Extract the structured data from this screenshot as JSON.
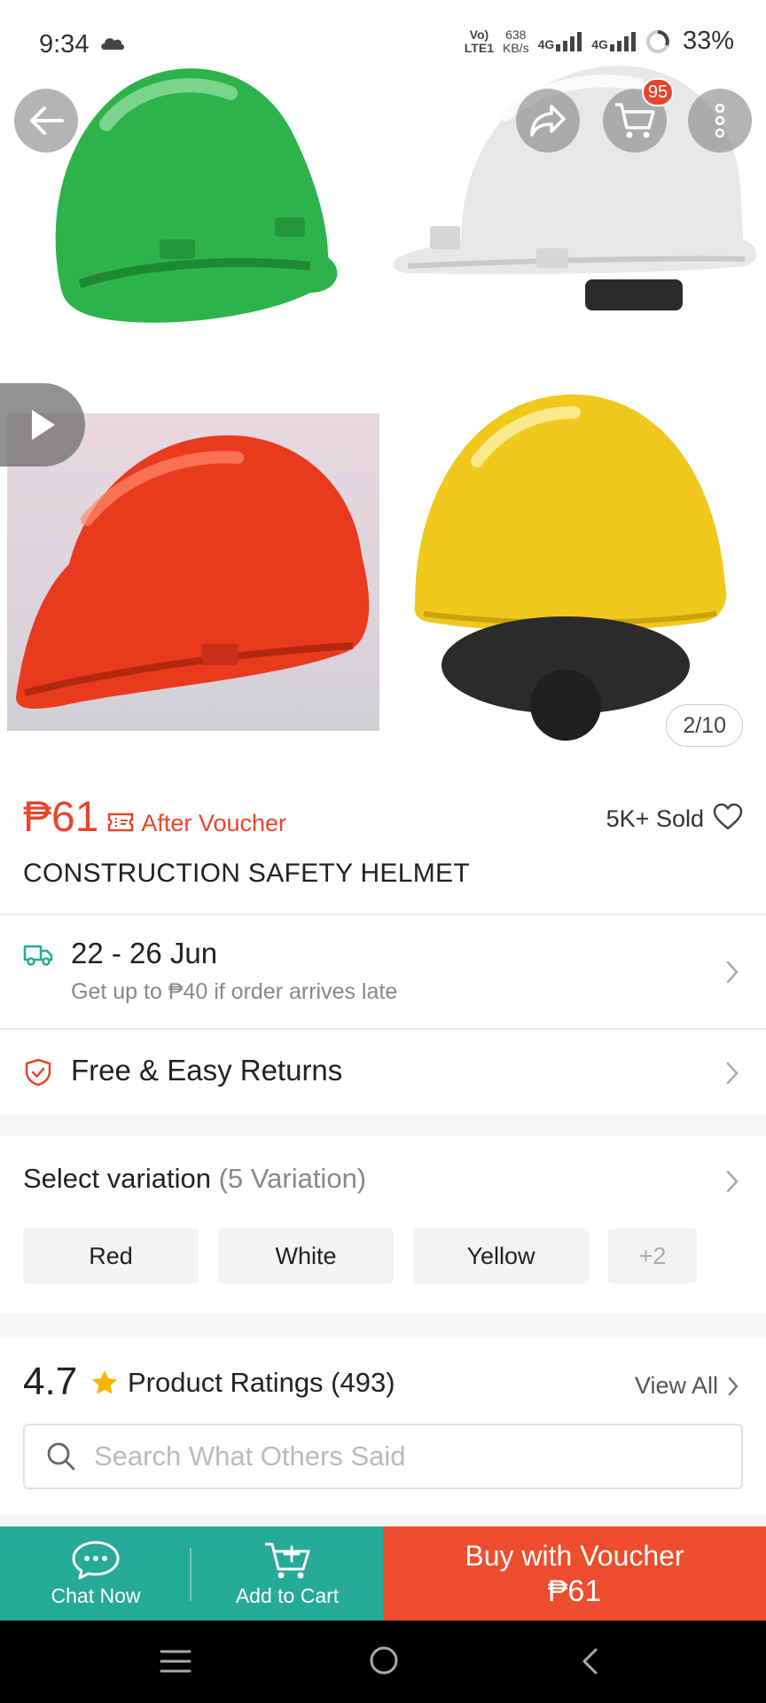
{
  "status_bar": {
    "time": "9:34",
    "network_label_top": "Vo)",
    "network_label_bottom": "LTE1",
    "speed_value": "638",
    "speed_unit": "KB/s",
    "signal1": "4G",
    "signal2": "4G",
    "battery": "33%"
  },
  "gallery": {
    "counter": "2/10",
    "cart_badge": "95",
    "helmet_colors": [
      "#2db34a",
      "#e6e6e6",
      "#ea3a1e",
      "#f1c91c"
    ]
  },
  "product": {
    "price": "₱61",
    "voucher_text": "After Voucher",
    "sold": "5K+ Sold",
    "title": "CONSTRUCTION SAFETY HELMET"
  },
  "delivery": {
    "date_range": "22 - 26 Jun",
    "guarantee": "Get up to ₱40 if order arrives late"
  },
  "returns": {
    "label": "Free & Easy Returns"
  },
  "variation": {
    "label": "Select variation",
    "count": "(5 Variation)",
    "options": [
      "Red",
      "White",
      "Yellow"
    ],
    "more": "+2"
  },
  "ratings": {
    "score": "4.7",
    "label": "Product Ratings (493)",
    "view_all": "View All",
    "search_placeholder": "Search What Others Said"
  },
  "actions": {
    "chat": "Chat Now",
    "cart": "Add to Cart",
    "buy_label": "Buy with Voucher",
    "buy_price": "₱61"
  },
  "colors": {
    "accent": "#ee4d2d",
    "teal": "#26aa99",
    "price": "#e8452d"
  }
}
